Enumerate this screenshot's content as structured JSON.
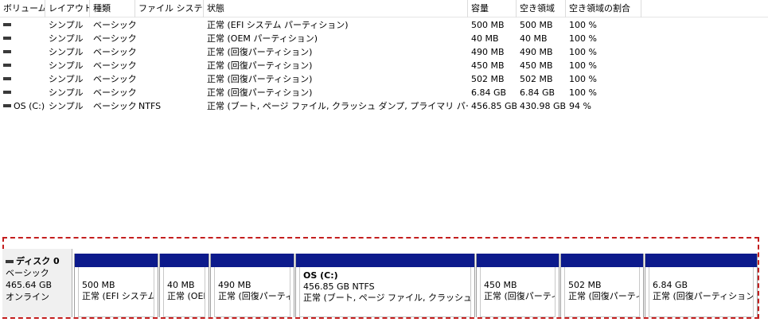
{
  "columns": [
    "ボリューム",
    "レイアウト",
    "種類",
    "ファイル システム",
    "状態",
    "容量",
    "空き領域",
    "空き領域の割合"
  ],
  "volumes": [
    {
      "name": "",
      "layout": "シンプル",
      "type": "ベーシック",
      "fs": "",
      "status": "正常 (EFI システム パーティション)",
      "capacity": "500 MB",
      "free": "500 MB",
      "pct": "100 %"
    },
    {
      "name": "",
      "layout": "シンプル",
      "type": "ベーシック",
      "fs": "",
      "status": "正常 (OEM パーティション)",
      "capacity": "40 MB",
      "free": "40 MB",
      "pct": "100 %"
    },
    {
      "name": "",
      "layout": "シンプル",
      "type": "ベーシック",
      "fs": "",
      "status": "正常 (回復パーティション)",
      "capacity": "490 MB",
      "free": "490 MB",
      "pct": "100 %"
    },
    {
      "name": "",
      "layout": "シンプル",
      "type": "ベーシック",
      "fs": "",
      "status": "正常 (回復パーティション)",
      "capacity": "450 MB",
      "free": "450 MB",
      "pct": "100 %"
    },
    {
      "name": "",
      "layout": "シンプル",
      "type": "ベーシック",
      "fs": "",
      "status": "正常 (回復パーティション)",
      "capacity": "502 MB",
      "free": "502 MB",
      "pct": "100 %"
    },
    {
      "name": "",
      "layout": "シンプル",
      "type": "ベーシック",
      "fs": "",
      "status": "正常 (回復パーティション)",
      "capacity": "6.84 GB",
      "free": "6.84 GB",
      "pct": "100 %"
    },
    {
      "name": "OS (C:)",
      "layout": "シンプル",
      "type": "ベーシック",
      "fs": "NTFS",
      "status": "正常 (ブート, ページ ファイル, クラッシュ ダンプ, プライマリ パーティション)",
      "capacity": "456.85 GB",
      "free": "430.98 GB",
      "pct": "94 %"
    }
  ],
  "disk": {
    "name": "ディスク 0",
    "type": "ベーシック",
    "size": "465.64 GB",
    "state": "オンライン"
  },
  "partitions": [
    {
      "title": "",
      "size": "500 MB",
      "status": "正常 (EFI システム パ"
    },
    {
      "title": "",
      "size": "40 MB",
      "status": "正常 (OEI"
    },
    {
      "title": "",
      "size": "490 MB",
      "status": "正常 (回復パーティ"
    },
    {
      "title": "OS  (C:)",
      "size": "456.85 GB NTFS",
      "status": "正常 (ブート, ページ ファイル, クラッシュ ダンプ,"
    },
    {
      "title": "",
      "size": "450 MB",
      "status": "正常 (回復パーティ"
    },
    {
      "title": "",
      "size": "502 MB",
      "status": "正常 (回復パーティ"
    },
    {
      "title": "",
      "size": "6.84 GB",
      "status": "正常 (回復パーティション)"
    }
  ],
  "colors": {
    "partition_bar": "#0c1a8c",
    "highlight_border": "#c41e1e"
  },
  "icons": {
    "volume": "drive-icon",
    "disk": "disk-icon"
  }
}
